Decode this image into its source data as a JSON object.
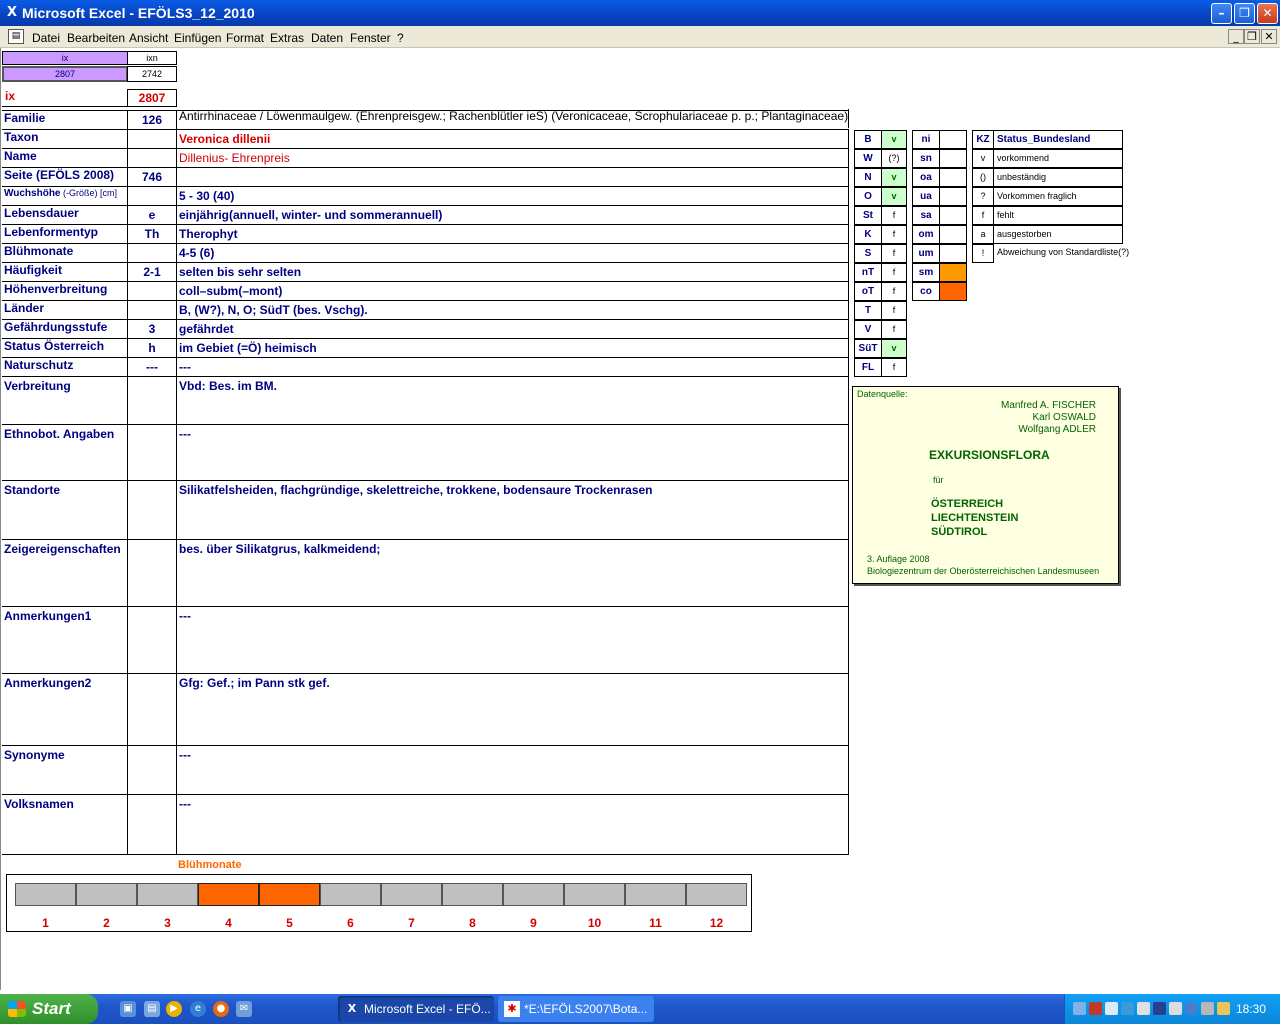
{
  "window": {
    "title": "Microsoft Excel - EFÖLS3_12_2010",
    "app_icon": "excel-x-icon"
  },
  "menu": {
    "items": [
      "Datei",
      "Bearbeiten",
      "Ansicht",
      "Einfügen",
      "Format",
      "Extras",
      "Daten",
      "Fenster",
      "?"
    ]
  },
  "top_cells": {
    "ix_header": "ix",
    "ixn_header": "ixn",
    "ix_value": "2807",
    "ixn_value": "2742",
    "ix_label": "ix",
    "ix_big": "2807"
  },
  "rows": [
    {
      "label": "Familie",
      "code": "126",
      "value": "Antirrhinaceae  /  Löwenmaulgew. (Ehrenpreisgew.; Rachenblütler ieS) (Veronicaceae, Scrophulariaceae p. p.; Plantaginaceae)"
    },
    {
      "label": "Taxon",
      "code": "",
      "value": "Veronica dillenii"
    },
    {
      "label": "Name",
      "code": "",
      "value": "Dillenius- Ehrenpreis"
    },
    {
      "label": "Seite (EFÖLS 2008)",
      "code": "746",
      "value": ""
    },
    {
      "label": "Wuchshöhe",
      "label_small": " (-Größe) [cm]",
      "code": "",
      "value": " 5 - 30 (40)"
    },
    {
      "label": "Lebensdauer",
      "code": "e",
      "value": "einjährig(annuell, winter- und sommerannuell)"
    },
    {
      "label": "Lebenformentyp",
      "code": "Th",
      "value": "Therophyt"
    },
    {
      "label": "Blühmonate",
      "code": "",
      "value": " 4-5 (6)"
    },
    {
      "label": "Häufigkeit",
      "code": "2-1",
      "value": "selten bis sehr selten"
    },
    {
      "label": "Höhenverbreitung",
      "code": "",
      "value": "coll–subm(–mont)"
    },
    {
      "label": "Länder",
      "code": "",
      "value": "B, (W?), N, O; SüdT (bes. Vschg)."
    },
    {
      "label": "Gefährdungsstufe",
      "code": "3",
      "value": "gefährdet"
    },
    {
      "label": "Status Österreich",
      "code": "h",
      "value": "im Gebiet (=Ö) heimisch"
    },
    {
      "label": "Naturschutz",
      "code": "---",
      "value": "---"
    }
  ],
  "big_rows": [
    {
      "label": "Verbreitung",
      "value": "Vbd: Bes. im BM."
    },
    {
      "label": "Ethnobot. Angaben",
      "value": "---"
    },
    {
      "label": "Standorte",
      "value": "Silikatfelsheiden, flachgründige, skelettreiche, trokkene, bodensaure Trockenrasen"
    },
    {
      "label": "Zeigereigenschaften",
      "value": "bes. über Silikatgrus, kalkmeidend;"
    },
    {
      "label": "Anmerkungen1",
      "value": "---"
    },
    {
      "label": "Anmerkungen2",
      "value": "Gfg: Gef.; im Pann stk gef."
    },
    {
      "label": "Synonyme",
      "value": "---"
    },
    {
      "label": "Volksnamen",
      "value": "---"
    }
  ],
  "bundesland": [
    {
      "code": "B",
      "status": "v",
      "green": true
    },
    {
      "code": "W",
      "status": "(?)",
      "green": false
    },
    {
      "code": "N",
      "status": "v",
      "green": true
    },
    {
      "code": "O",
      "status": "v",
      "green": true
    },
    {
      "code": "St",
      "status": "f",
      "green": false
    },
    {
      "code": "K",
      "status": "f",
      "green": false
    },
    {
      "code": "S",
      "status": "f",
      "green": false
    },
    {
      "code": "nT",
      "status": "f",
      "green": false
    },
    {
      "code": "oT",
      "status": "f",
      "green": false
    },
    {
      "code": "T",
      "status": "f",
      "green": false
    },
    {
      "code": "V",
      "status": "f",
      "green": false
    },
    {
      "code": "SüT",
      "status": "v",
      "green": true
    },
    {
      "code": "FL",
      "status": "f",
      "green": false
    }
  ],
  "hoehen": [
    {
      "code": "ni",
      "active": false
    },
    {
      "code": "sn",
      "active": false
    },
    {
      "code": "oa",
      "active": false
    },
    {
      "code": "ua",
      "active": false
    },
    {
      "code": "sa",
      "active": false
    },
    {
      "code": "om",
      "active": false
    },
    {
      "code": "um",
      "active": false
    },
    {
      "code": "sm",
      "active": true
    },
    {
      "code": "co",
      "active": true
    }
  ],
  "legend": {
    "kz_header": "KZ",
    "status_header": "Status_Bundesland",
    "entries": [
      {
        "code": "v",
        "text": "vorkommend"
      },
      {
        "code": "()",
        "text": "unbeständig"
      },
      {
        "code": "?",
        "text": "Vorkommen fraglich"
      },
      {
        "code": "f",
        "text": "fehlt"
      },
      {
        "code": "a",
        "text": "ausgestorben"
      },
      {
        "code": "!",
        "text": "Abweichung von Standardliste(?)"
      }
    ]
  },
  "source": {
    "heading": "Datenquelle:",
    "authors": [
      "Manfred A. FISCHER",
      "Karl OSWALD",
      "Wolfgang ADLER"
    ],
    "book": "EXKURSIONSFLORA",
    "fuer": "für",
    "countries": [
      "ÖSTERREICH",
      "LIECHTENSTEIN",
      "SÜDTIROL"
    ],
    "edition": "3. Auflage 2008",
    "publisher": "Biologiezentrum der Oberösterreichischen Landesmuseen"
  },
  "chart_data": {
    "type": "bar",
    "title": "Blühmonate",
    "categories": [
      "1",
      "2",
      "3",
      "4",
      "5",
      "6",
      "7",
      "8",
      "9",
      "10",
      "11",
      "12"
    ],
    "flowering": [
      false,
      false,
      false,
      true,
      true,
      false,
      false,
      false,
      false,
      false,
      false,
      false
    ],
    "colors": {
      "on": "#ff6600",
      "off": "#c0c0c0"
    }
  },
  "taskbar": {
    "start": "Start",
    "items": [
      {
        "label": "Microsoft Excel - EFÖ...",
        "icon": "excel-icon",
        "active": true
      },
      {
        "label": "*E:\\EFÖLS2007\\Bota...",
        "icon": "document-icon",
        "active": false
      }
    ],
    "clock": "18:30"
  },
  "colors": {
    "purple": "#cc99ff",
    "green": "#ccffcc",
    "orange": "#ff9900",
    "orange2": "#ff6600",
    "navy": "#000080",
    "red": "#d40000"
  }
}
